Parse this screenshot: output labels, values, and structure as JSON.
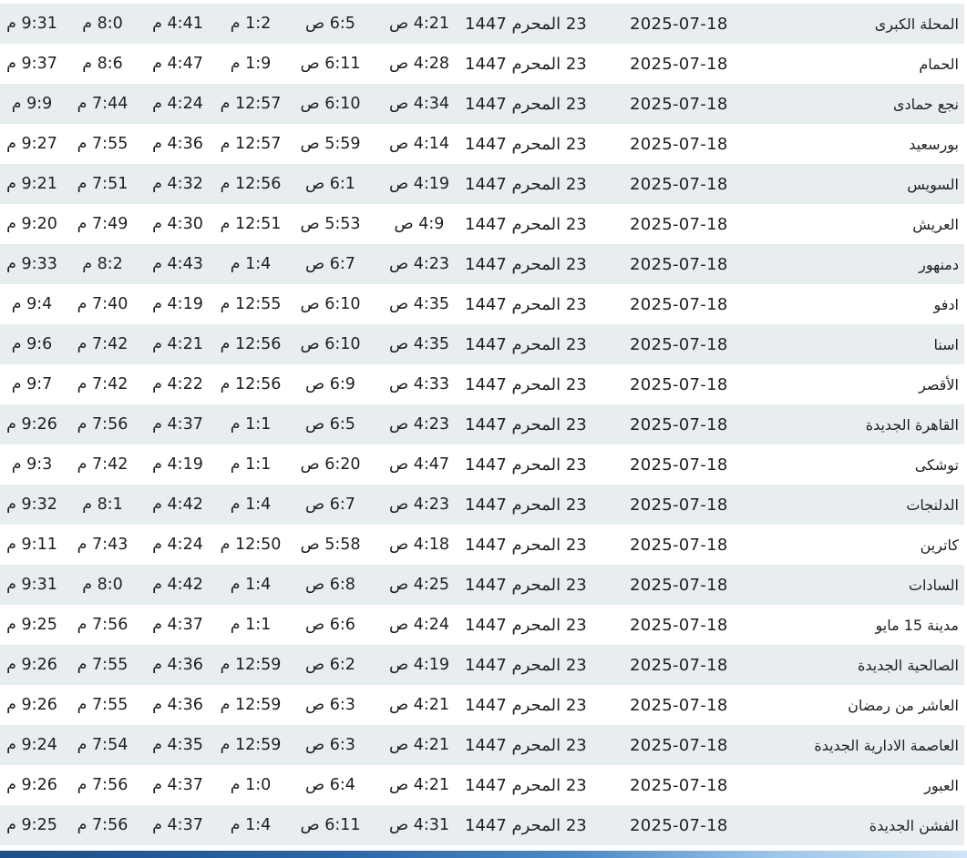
{
  "rows": [
    {
      "city": "المحلة الكبرى",
      "date": "2025-07-18",
      "hijri": "23 المحرم 1447",
      "fajr": "4:21 ص",
      "sunrise": "6:5 ص",
      "dhuhr": "1:2 م",
      "asr": "4:41 م",
      "maghrib": "8:0 م",
      "isha": "9:31 م"
    },
    {
      "city": "الحمام",
      "date": "2025-07-18",
      "hijri": "23 المحرم 1447",
      "fajr": "4:28 ص",
      "sunrise": "6:11 ص",
      "dhuhr": "1:9 م",
      "asr": "4:47 م",
      "maghrib": "8:6 م",
      "isha": "9:37 م"
    },
    {
      "city": "نجع حمادى",
      "date": "2025-07-18",
      "hijri": "23 المحرم 1447",
      "fajr": "4:34 ص",
      "sunrise": "6:10 ص",
      "dhuhr": "12:57 م",
      "asr": "4:24 م",
      "maghrib": "7:44 م",
      "isha": "9:9 م"
    },
    {
      "city": "بورسعيد",
      "date": "2025-07-18",
      "hijri": "23 المحرم 1447",
      "fajr": "4:14 ص",
      "sunrise": "5:59 ص",
      "dhuhr": "12:57 م",
      "asr": "4:36 م",
      "maghrib": "7:55 م",
      "isha": "9:27 م"
    },
    {
      "city": "السويس",
      "date": "2025-07-18",
      "hijri": "23 المحرم 1447",
      "fajr": "4:19 ص",
      "sunrise": "6:1 ص",
      "dhuhr": "12:56 م",
      "asr": "4:32 م",
      "maghrib": "7:51 م",
      "isha": "9:21 م"
    },
    {
      "city": "العريش",
      "date": "2025-07-18",
      "hijri": "23 المحرم 1447",
      "fajr": "4:9 ص",
      "sunrise": "5:53 ص",
      "dhuhr": "12:51 م",
      "asr": "4:30 م",
      "maghrib": "7:49 م",
      "isha": "9:20 م"
    },
    {
      "city": "دمنهور",
      "date": "2025-07-18",
      "hijri": "23 المحرم 1447",
      "fajr": "4:23 ص",
      "sunrise": "6:7 ص",
      "dhuhr": "1:4 م",
      "asr": "4:43 م",
      "maghrib": "8:2 م",
      "isha": "9:33 م"
    },
    {
      "city": "ادفو",
      "date": "2025-07-18",
      "hijri": "23 المحرم 1447",
      "fajr": "4:35 ص",
      "sunrise": "6:10 ص",
      "dhuhr": "12:55 م",
      "asr": "4:19 م",
      "maghrib": "7:40 م",
      "isha": "9:4 م"
    },
    {
      "city": "اسنا",
      "date": "2025-07-18",
      "hijri": "23 المحرم 1447",
      "fajr": "4:35 ص",
      "sunrise": "6:10 ص",
      "dhuhr": "12:56 م",
      "asr": "4:21 م",
      "maghrib": "7:42 م",
      "isha": "9:6 م"
    },
    {
      "city": "الأقصر",
      "date": "2025-07-18",
      "hijri": "23 المحرم 1447",
      "fajr": "4:33 ص",
      "sunrise": "6:9 ص",
      "dhuhr": "12:56 م",
      "asr": "4:22 م",
      "maghrib": "7:42 م",
      "isha": "9:7 م"
    },
    {
      "city": "القاهرة الجديدة",
      "date": "2025-07-18",
      "hijri": "23 المحرم 1447",
      "fajr": "4:23 ص",
      "sunrise": "6:5 ص",
      "dhuhr": "1:1 م",
      "asr": "4:37 م",
      "maghrib": "7:56 م",
      "isha": "9:26 م"
    },
    {
      "city": "توشكى",
      "date": "2025-07-18",
      "hijri": "23 المحرم 1447",
      "fajr": "4:47 ص",
      "sunrise": "6:20 ص",
      "dhuhr": "1:1 م",
      "asr": "4:19 م",
      "maghrib": "7:42 م",
      "isha": "9:3 م"
    },
    {
      "city": "الدلنجات",
      "date": "2025-07-18",
      "hijri": "23 المحرم 1447",
      "fajr": "4:23 ص",
      "sunrise": "6:7 ص",
      "dhuhr": "1:4 م",
      "asr": "4:42 م",
      "maghrib": "8:1 م",
      "isha": "9:32 م"
    },
    {
      "city": "كاترين",
      "date": "2025-07-18",
      "hijri": "23 المحرم 1447",
      "fajr": "4:18 ص",
      "sunrise": "5:58 ص",
      "dhuhr": "12:50 م",
      "asr": "4:24 م",
      "maghrib": "7:43 م",
      "isha": "9:11 م"
    },
    {
      "city": "السادات",
      "date": "2025-07-18",
      "hijri": "23 المحرم 1447",
      "fajr": "4:25 ص",
      "sunrise": "6:8 ص",
      "dhuhr": "1:4 م",
      "asr": "4:42 م",
      "maghrib": "8:0 م",
      "isha": "9:31 م"
    },
    {
      "city": "مدينة 15 مايو",
      "date": "2025-07-18",
      "hijri": "23 المحرم 1447",
      "fajr": "4:24 ص",
      "sunrise": "6:6 ص",
      "dhuhr": "1:1 م",
      "asr": "4:37 م",
      "maghrib": "7:56 م",
      "isha": "9:25 م"
    },
    {
      "city": "الصالحية الجديدة",
      "date": "2025-07-18",
      "hijri": "23 المحرم 1447",
      "fajr": "4:19 ص",
      "sunrise": "6:2 ص",
      "dhuhr": "12:59 م",
      "asr": "4:36 م",
      "maghrib": "7:55 م",
      "isha": "9:26 م"
    },
    {
      "city": "العاشر من رمضان",
      "date": "2025-07-18",
      "hijri": "23 المحرم 1447",
      "fajr": "4:21 ص",
      "sunrise": "6:3 ص",
      "dhuhr": "12:59 م",
      "asr": "4:36 م",
      "maghrib": "7:55 م",
      "isha": "9:26 م"
    },
    {
      "city": "العاصمة الادارية الجديدة",
      "date": "2025-07-18",
      "hijri": "23 المحرم 1447",
      "fajr": "4:21 ص",
      "sunrise": "6:3 ص",
      "dhuhr": "12:59 م",
      "asr": "4:35 م",
      "maghrib": "7:54 م",
      "isha": "9:24 م"
    },
    {
      "city": "العبور",
      "date": "2025-07-18",
      "hijri": "23 المحرم 1447",
      "fajr": "4:21 ص",
      "sunrise": "6:4 ص",
      "dhuhr": "1:0 م",
      "asr": "4:37 م",
      "maghrib": "7:56 م",
      "isha": "9:26 م"
    },
    {
      "city": "الفشن الجديدة",
      "date": "2025-07-18",
      "hijri": "23 المحرم 1447",
      "fajr": "4:31 ص",
      "sunrise": "6:11 ص",
      "dhuhr": "1:4 م",
      "asr": "4:37 م",
      "maghrib": "7:56 م",
      "isha": "9:25 م"
    }
  ]
}
